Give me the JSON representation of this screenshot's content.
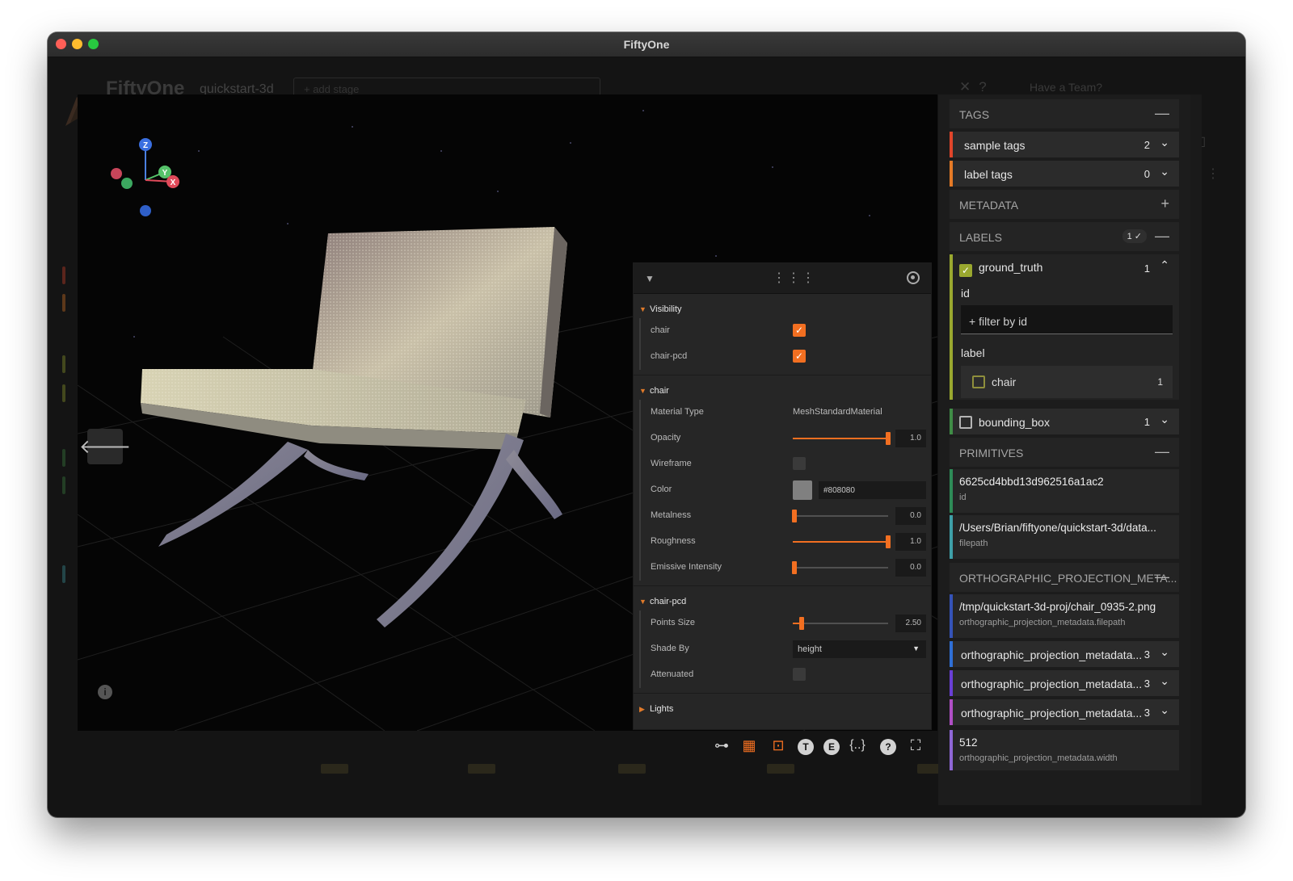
{
  "window": {
    "title": "FiftyOne"
  },
  "app": {
    "brand": "FiftyOne",
    "dataset": "quickstart-3d",
    "add_stage_placeholder": "+ add stage",
    "team_link": "Have a Team?"
  },
  "viewport": {
    "axes": {
      "z": "Z",
      "y": "Y",
      "x": "X"
    },
    "nav_prev_icon": "arrow-left-icon",
    "info_icon": "i"
  },
  "controls": {
    "drag_handle": "⋮⋮",
    "visibility": {
      "title": "Visibility",
      "items": [
        {
          "label": "chair",
          "checked": true
        },
        {
          "label": "chair-pcd",
          "checked": true
        }
      ]
    },
    "chair": {
      "title": "chair",
      "material_type_label": "Material Type",
      "material_type_value": "MeshStandardMaterial",
      "opacity_label": "Opacity",
      "opacity_value": "1.0",
      "wireframe_label": "Wireframe",
      "wireframe_checked": false,
      "color_label": "Color",
      "color_value": "#808080",
      "metalness_label": "Metalness",
      "metalness_value": "0.0",
      "roughness_label": "Roughness",
      "roughness_value": "1.0",
      "emissive_label": "Emissive Intensity",
      "emissive_value": "0.0"
    },
    "chair_pcd": {
      "title": "chair-pcd",
      "points_size_label": "Points Size",
      "points_size_value": "2.50",
      "shade_by_label": "Shade By",
      "shade_by_value": "height",
      "attenuated_label": "Attenuated",
      "attenuated_checked": false
    },
    "lights": {
      "title": "Lights"
    },
    "colors": {
      "accent": "#f26f21"
    }
  },
  "toolbar": {
    "tools": [
      "hierarchy-icon",
      "grid-icon",
      "image-icon",
      "T",
      "E",
      "{..}",
      "?",
      "fullscreen-icon"
    ],
    "text_t": "T",
    "text_e": "E",
    "text_json": "{..}",
    "text_help": "?"
  },
  "sidebar": {
    "tags": {
      "title": "TAGS",
      "sample_tags": {
        "label": "sample tags",
        "count": "2",
        "color": "#e0452a"
      },
      "label_tags": {
        "label": "label tags",
        "count": "0",
        "color": "#e57a26"
      }
    },
    "metadata": {
      "title": "METADATA"
    },
    "labels": {
      "title": "LABELS",
      "badge": "1 ✓",
      "ground_truth": {
        "label": "ground_truth",
        "count": "1",
        "color": "#9aa82f",
        "id_title": "id",
        "filter_placeholder": "+ filter by id",
        "label_title": "label",
        "label_value": "chair",
        "label_value_count": "1"
      },
      "bounding_box": {
        "label": "bounding_box",
        "count": "1",
        "color": "#3f8c46"
      }
    },
    "primitives": {
      "title": "PRIMITIVES",
      "items": [
        {
          "value": "6625cd4bbd13d962516a1ac2",
          "key": "id",
          "color": "#2e8b57"
        },
        {
          "value": "/Users/Brian/fiftyone/quickstart-3d/data...",
          "key": "filepath",
          "color": "#3ea0a8"
        }
      ]
    },
    "ortho": {
      "title": "ORTHOGRAPHIC_PROJECTION_META...",
      "filepath": {
        "value": "/tmp/quickstart-3d-proj/chair_0935-2.png",
        "key": "orthographic_projection_metadata.filepath",
        "color": "#3553b8"
      },
      "rows": [
        {
          "label": "orthographic_projection_metadata...",
          "count": "3",
          "color": "#2f6fd6"
        },
        {
          "label": "orthographic_projection_metadata...",
          "count": "3",
          "color": "#6a3fd6"
        },
        {
          "label": "orthographic_projection_metadata...",
          "count": "3",
          "color": "#b04fc6"
        }
      ],
      "width": {
        "value": "512",
        "key": "orthographic_projection_metadata.width",
        "color": "#8f67d6"
      }
    }
  }
}
